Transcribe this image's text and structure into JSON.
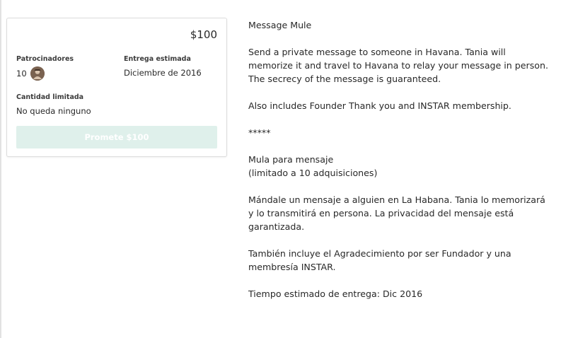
{
  "reward": {
    "price": "$100",
    "backers_label": "Patrocinadores",
    "backers_count": "10",
    "delivery_label": "Entrega estimada",
    "delivery_value": "Diciembre de 2016",
    "limited_label": "Cantidad limitada",
    "limited_value": "No queda ninguno",
    "pledge_button": "Promete $100"
  },
  "description": {
    "title": "Message Mule",
    "en_line1": "Send a private message to someone in Havana. Tania will",
    "en_line2": "memorize it and travel to Havana to relay your message in person.",
    "en_line3": "The secrecy of the message is guaranteed.",
    "en_includes": "Also includes Founder Thank you and INSTAR membership.",
    "separator": "*****",
    "es_title": "Mula para mensaje",
    "es_limit": "(limitado a 10 adquisiciones)",
    "es_line1": "Mándale un mensaje a alguien en La Habana. Tania lo memorizará",
    "es_line2": "y lo transmitirá en persona. La privacidad del mensaje está",
    "es_line3": "garantizada.",
    "es_includes1": "También incluye el Agradecimiento por ser Fundador y una",
    "es_includes2": "membresía INSTAR.",
    "es_delivery": "Tiempo estimado de entrega: Dic 2016"
  },
  "colors": {
    "button_bg": "#dff0eb",
    "text": "#282828"
  },
  "icons": {
    "backer_avatar": "backer-avatar-icon"
  }
}
